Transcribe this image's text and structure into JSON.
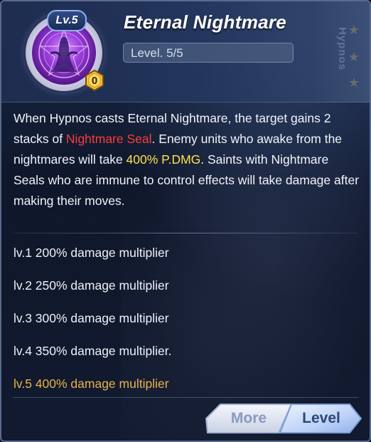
{
  "skill": {
    "level_badge": "Lv.5",
    "star_count": "0",
    "name": "Eternal Nightmare",
    "level_text": "Level. 5/5"
  },
  "background": {
    "vertical_text": "Hypnos"
  },
  "description": {
    "part1": "When Hypnos casts Eternal Nightmare, the target gains 2 stacks of ",
    "red": "Nightmare Seal",
    "part2": ". Enemy units who awake from the nightmares will take ",
    "yellow": "400% P.DMG",
    "part3": ". Saints with Nightmare Seals who are immune to control effects will take damage after making their moves."
  },
  "levels": [
    {
      "text": "lv.1 200% damage multiplier",
      "current": false
    },
    {
      "text": "lv.2 250% damage multiplier",
      "current": false
    },
    {
      "text": "lv.3 300% damage multiplier",
      "current": false
    },
    {
      "text": "lv.4 350% damage multiplier.",
      "current": false
    },
    {
      "text": "lv.5 400% damage multiplier",
      "current": true
    }
  ],
  "buttons": {
    "more": "More",
    "level": "Level"
  },
  "colors": {
    "highlight_red": "#ff3b3b",
    "highlight_yellow": "#ffe14a",
    "current_level": "#e9b14a"
  },
  "icons": [
    "magic-circle-icon",
    "star-badge-icon"
  ]
}
